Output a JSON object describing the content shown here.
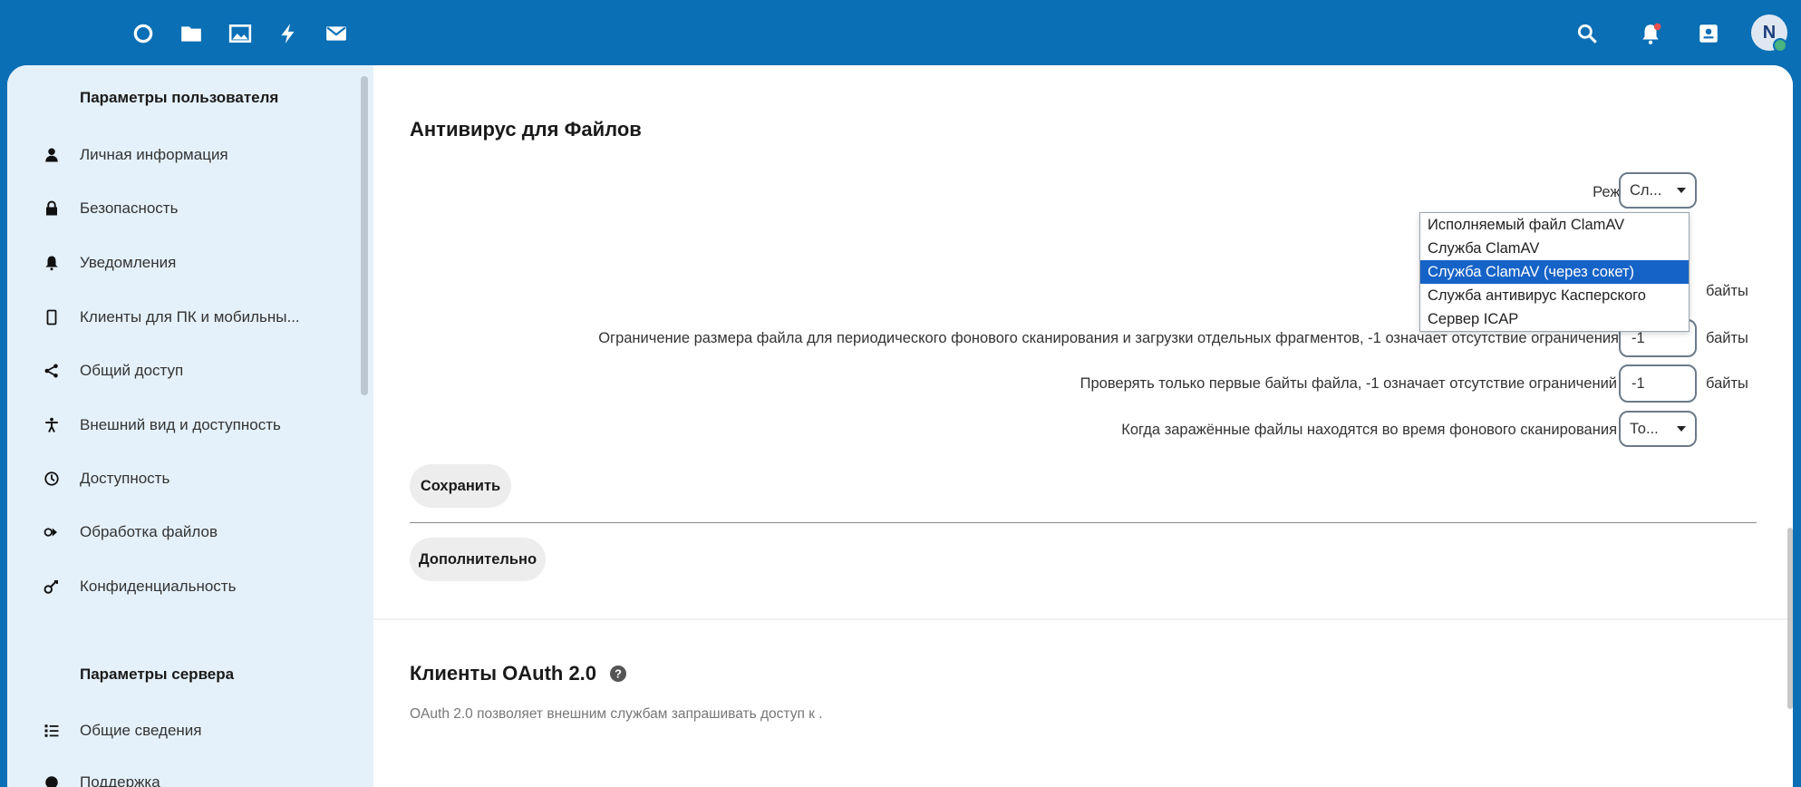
{
  "colors": {
    "header_bg": "#0a6fb5",
    "sidebar_bg": "#e5f1fa",
    "selected_option_bg": "#1663c7",
    "status_online": "#49b382"
  },
  "header": {
    "apps": [
      {
        "name": "dashboard-icon"
      },
      {
        "name": "files-folder-icon"
      },
      {
        "name": "photos-icon"
      },
      {
        "name": "activity-lightning-icon"
      },
      {
        "name": "mail-icon"
      }
    ],
    "right_icons": [
      {
        "name": "search-icon"
      },
      {
        "name": "notifications-bell-icon"
      },
      {
        "name": "contacts-icon"
      }
    ],
    "avatar_initial": "N"
  },
  "sidebar": {
    "personal_heading": "Параметры пользователя",
    "personal_items": [
      {
        "label": "Личная информация",
        "icon": "person-icon"
      },
      {
        "label": "Безопасность",
        "icon": "lock-icon"
      },
      {
        "label": "Уведомления",
        "icon": "bell-icon"
      },
      {
        "label": "Клиенты для ПК и мобильны...",
        "icon": "phone-icon"
      },
      {
        "label": "Общий доступ",
        "icon": "share-icon"
      },
      {
        "label": "Внешний вид и доступность",
        "icon": "accessibility-icon"
      },
      {
        "label": "Доступность",
        "icon": "clock-icon"
      },
      {
        "label": "Обработка файлов",
        "icon": "flow-icon"
      },
      {
        "label": "Конфиденциальность",
        "icon": "key-icon"
      }
    ],
    "server_heading": "Параметры сервера",
    "server_items": [
      {
        "label": "Общие сведения",
        "icon": "list-icon"
      },
      {
        "label": "Поддержка",
        "icon": "support-icon"
      }
    ]
  },
  "antivirus": {
    "title": "Антивирус для Файлов",
    "mode_label": "Режим",
    "mode_value": "Сл...",
    "mode_options": [
      "Исполняемый файл ClamAV",
      "Служба ClamAV",
      "Служба ClamAV (через сокет)",
      "Служба антивирус Касперского",
      "Сервер ICAP"
    ],
    "mode_selected_index": 2,
    "row1_unit": "байты",
    "row2_label": "Ограничение размера файла для периодического фонового сканирования и загрузки отдельных фрагментов, -1 означает отсутствие ограничения",
    "row2_value": "-1",
    "row2_unit": "байты",
    "row3_label": "Проверять только первые байты файла, -1 означает отсутствие ограничений",
    "row3_value": "-1",
    "row3_unit": "байты",
    "row4_label": "Когда заражённые файлы находятся во время фонового сканирования",
    "row4_value": "То...",
    "save_button": "Сохранить",
    "advanced_button": "Дополнительно"
  },
  "oauth": {
    "title": "Клиенты OAuth 2.0",
    "description": "OAuth 2.0 позволяет внешним службам запрашивать доступ к ."
  }
}
